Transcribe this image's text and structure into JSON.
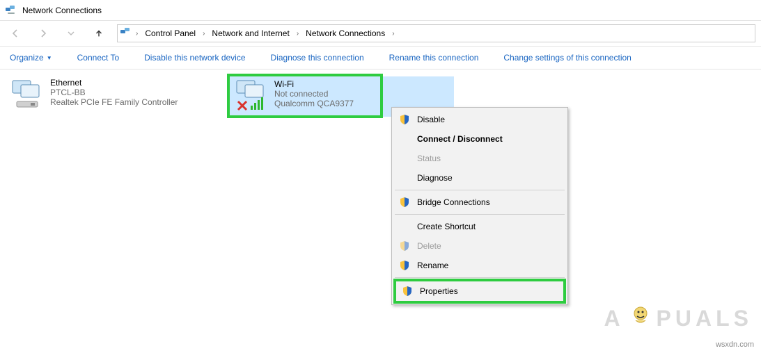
{
  "window": {
    "title": "Network Connections"
  },
  "breadcrumb": {
    "seg1": "Control Panel",
    "seg2": "Network and Internet",
    "seg3": "Network Connections"
  },
  "toolbar": {
    "organize": "Organize",
    "connect_to": "Connect To",
    "disable": "Disable this network device",
    "diagnose": "Diagnose this connection",
    "rename": "Rename this connection",
    "change_settings": "Change settings of this connection"
  },
  "adapters": {
    "ethernet": {
      "name": "Ethernet",
      "network": "PTCL-BB",
      "device": "Realtek PCIe FE Family Controller"
    },
    "wifi": {
      "name": "Wi-Fi",
      "status": "Not connected",
      "device": "Qualcomm QCA9377"
    }
  },
  "context_menu": {
    "disable": "Disable",
    "connect_disconnect": "Connect / Disconnect",
    "status": "Status",
    "diagnose": "Diagnose",
    "bridge": "Bridge Connections",
    "create_shortcut": "Create Shortcut",
    "delete": "Delete",
    "rename": "Rename",
    "properties": "Properties"
  },
  "watermark": {
    "text_a": "A",
    "text_rest": "PUALS"
  },
  "credit": "wsxdn.com",
  "icons": {
    "shield": "shield-icon",
    "monitor": "monitor-icon",
    "signal": "signal-icon",
    "cross": "cross-icon"
  }
}
